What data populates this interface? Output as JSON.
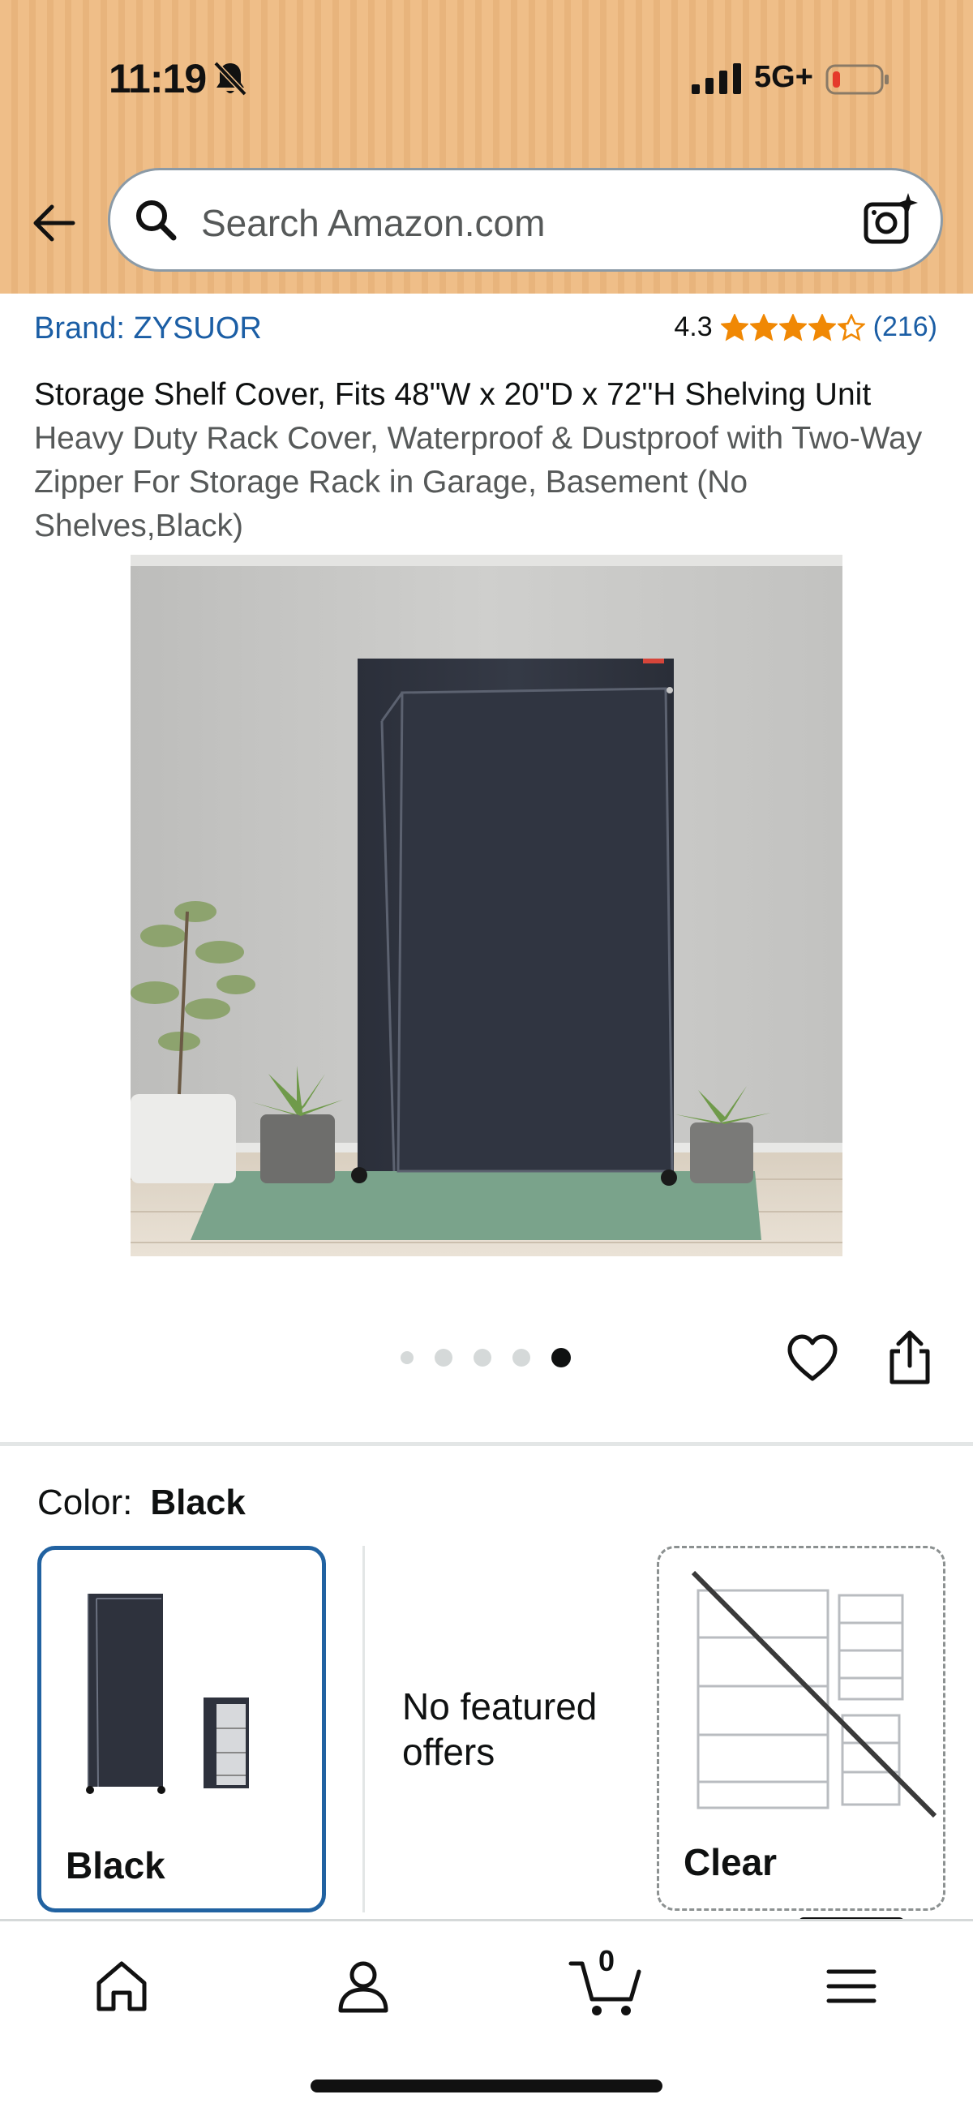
{
  "status_bar": {
    "time": "11:19",
    "network": "5G+"
  },
  "search": {
    "placeholder": "Search Amazon.com"
  },
  "product": {
    "brand": "Brand: ZYSUOR",
    "rating": "4.3",
    "rating_stars": 4.3,
    "rating_count": "(216)",
    "title_bold": "Storage Shelf Cover, Fits 48\"W x 20\"D x 72\"H Shelving Unit",
    "title_rest": "Heavy Duty Rack Cover, Waterproof & Dustproof with Two-Way Zipper For Storage Rack in Garage, Basement (No Shelves,Black)"
  },
  "carousel": {
    "image_count": 5,
    "active_index": 4
  },
  "color": {
    "label": "Color:",
    "selected": "Black",
    "options": [
      {
        "label": "Black",
        "selected": true
      },
      {
        "label": "Clear",
        "selected": false,
        "available": false
      }
    ],
    "no_offers": "No featured offers"
  },
  "cart": {
    "count": "0"
  },
  "colors": {
    "header_bg": "#efbe88",
    "link_blue": "#1b5ea5",
    "star_orange": "#f08804",
    "selected_border": "#2162a1"
  }
}
